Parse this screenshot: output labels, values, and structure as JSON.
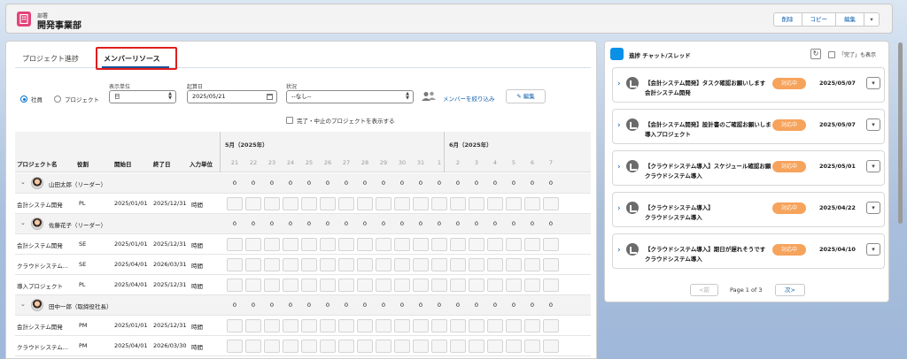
{
  "header": {
    "object_type": "部署",
    "record_name": "開発事業部",
    "actions": [
      "削除",
      "コピー",
      "編集"
    ]
  },
  "tabs": [
    {
      "label": "プロジェクト進捗",
      "active": false
    },
    {
      "label": "メンバーリソース",
      "active": true
    }
  ],
  "filters": {
    "radio_employee": "社員",
    "radio_project": "プロジェクト",
    "unit_label": "表示単位",
    "unit_value": "日",
    "start_label": "起算日",
    "start_value": "2025/05/21",
    "status_label": "状況",
    "status_value": "--なし--",
    "filter_members_link": "メンバーを絞り込み",
    "edit_button": "編集",
    "show_completed_label": "完了・中止のプロジェクトを表示する"
  },
  "grid": {
    "months": [
      "5月（2025年）",
      "6月（2025年）"
    ],
    "columns": [
      "プロジェクト名",
      "役割",
      "開始日",
      "終了日",
      "入力単位"
    ],
    "days": [
      "21",
      "22",
      "23",
      "24",
      "25",
      "26",
      "27",
      "28",
      "29",
      "30",
      "31",
      "1",
      "2",
      "3",
      "4",
      "5",
      "6",
      "7"
    ],
    "rows": [
      {
        "type": "group",
        "label": "山田太郎（リーダー）",
        "values": [
          "0",
          "0",
          "0",
          "0",
          "0",
          "0",
          "0",
          "0",
          "0",
          "0",
          "0",
          "0",
          "0",
          "0",
          "0",
          "0",
          "0",
          "0"
        ]
      },
      {
        "type": "item",
        "project": "会計システム開発",
        "role": "PL",
        "start": "2025/01/01",
        "end": "2025/12/31",
        "unit": "時間"
      },
      {
        "type": "group",
        "label": "佐藤花子（リーダー）",
        "values": [
          "0",
          "0",
          "0",
          "0",
          "0",
          "0",
          "0",
          "0",
          "0",
          "0",
          "0",
          "0",
          "0",
          "0",
          "0",
          "0",
          "0",
          "0"
        ]
      },
      {
        "type": "item",
        "project": "会計システム開発",
        "role": "SE",
        "start": "2025/01/01",
        "end": "2025/12/31",
        "unit": "時間"
      },
      {
        "type": "item",
        "project": "クラウドシステム...",
        "role": "SE",
        "start": "2025/04/01",
        "end": "2026/03/31",
        "unit": "時間"
      },
      {
        "type": "item",
        "project": "導入プロジェクト",
        "role": "PL",
        "start": "2025/04/01",
        "end": "2025/12/31",
        "unit": "時間"
      },
      {
        "type": "group",
        "label": "田中一郎（取締役社長）",
        "values": [
          "0",
          "0",
          "0",
          "0",
          "0",
          "0",
          "0",
          "0",
          "0",
          "0",
          "0",
          "0",
          "0",
          "0",
          "0",
          "0",
          "0",
          "0"
        ]
      },
      {
        "type": "item",
        "project": "会計システム開発",
        "role": "PM",
        "start": "2025/01/01",
        "end": "2025/12/31",
        "unit": "時間"
      },
      {
        "type": "item",
        "project": "クラウドシステム...",
        "role": "PM",
        "start": "2025/04/01",
        "end": "2026/03/30",
        "unit": "時間"
      }
    ]
  },
  "chat": {
    "title": "進捗 チャット/スレッド",
    "show_completed": "「完了」も表示",
    "threads": [
      {
        "title": "【会計システム開発】タスク確認お願いします",
        "subtitle": "会計システム開発",
        "status": "対応中",
        "date": "2025/05/07"
      },
      {
        "title": "【会計システム開発】設計書のご確認お願いします",
        "subtitle": "導入プロジェクト",
        "status": "対応中",
        "date": "2025/05/07"
      },
      {
        "title": "【クラウドシステム導入】スケジュール確認お願いします",
        "subtitle": "クラウドシステム導入",
        "status": "対応中",
        "date": "2025/05/01"
      },
      {
        "title": "【クラウドシステム導入】",
        "subtitle": "クラウドシステム導入",
        "status": "対応中",
        "date": "2025/04/22"
      },
      {
        "title": "【クラウドシステム導入】期日が遅れそうです",
        "subtitle": "クラウドシステム導入",
        "status": "対応中",
        "date": "2025/04/10"
      }
    ],
    "pager": {
      "prev": "<前",
      "page_text": "Page 1 of 3",
      "next": "次>"
    }
  },
  "colors": {
    "accent": "#0b5cab",
    "brand_icon": "#e3447a",
    "badge": "#f6a35c",
    "highlight_frame": "#e01e1e"
  }
}
